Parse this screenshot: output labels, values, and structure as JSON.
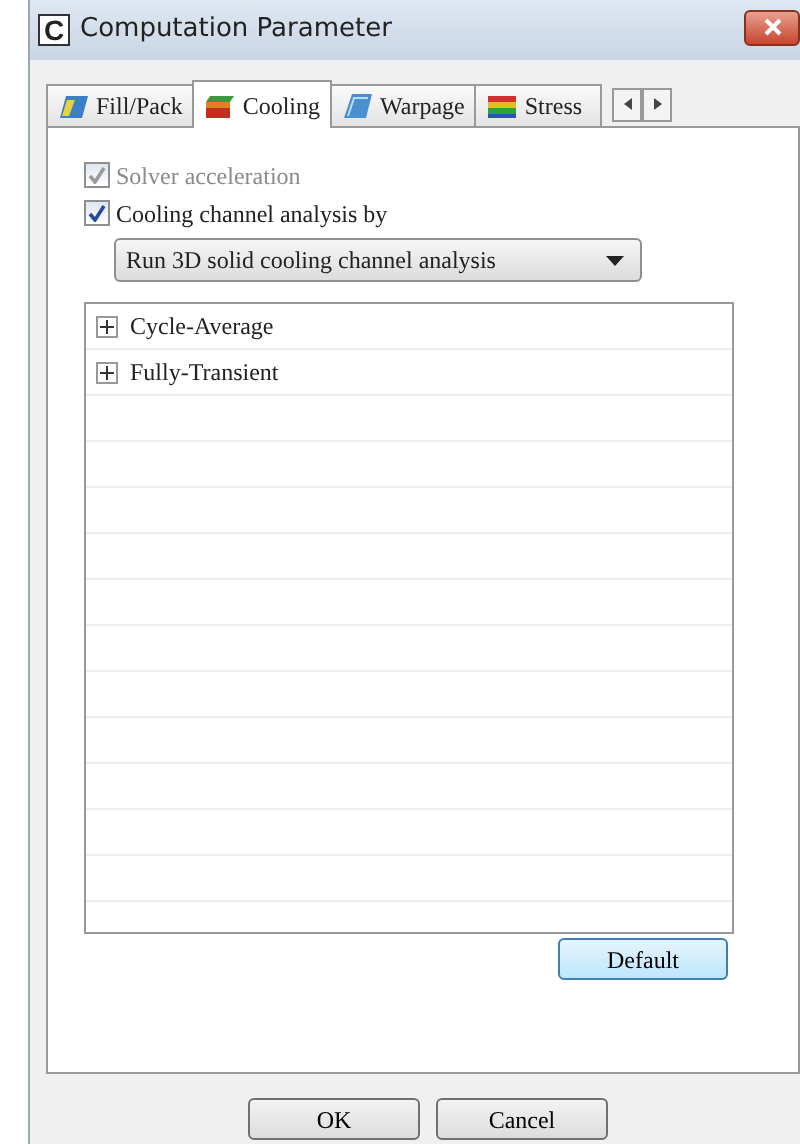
{
  "window": {
    "title": "Computation Parameter",
    "logo": "C"
  },
  "tabs": [
    {
      "label": "Fill/Pack",
      "selected": false
    },
    {
      "label": "Cooling",
      "selected": true
    },
    {
      "label": "Warpage",
      "selected": false
    },
    {
      "label": "Stress",
      "selected": false
    }
  ],
  "options": [
    {
      "label": "Solver acceleration",
      "checked": true,
      "disabled": true
    },
    {
      "label": "Cooling channel analysis by",
      "checked": true,
      "disabled": false
    }
  ],
  "analysis_select": {
    "value": "Run 3D solid cooling channel analysis"
  },
  "tree": [
    {
      "label": "Cycle-Average",
      "expanded": false
    },
    {
      "label": "Fully-Transient",
      "expanded": false
    }
  ],
  "buttons": {
    "default": "Default",
    "ok": "OK",
    "cancel": "Cancel"
  }
}
